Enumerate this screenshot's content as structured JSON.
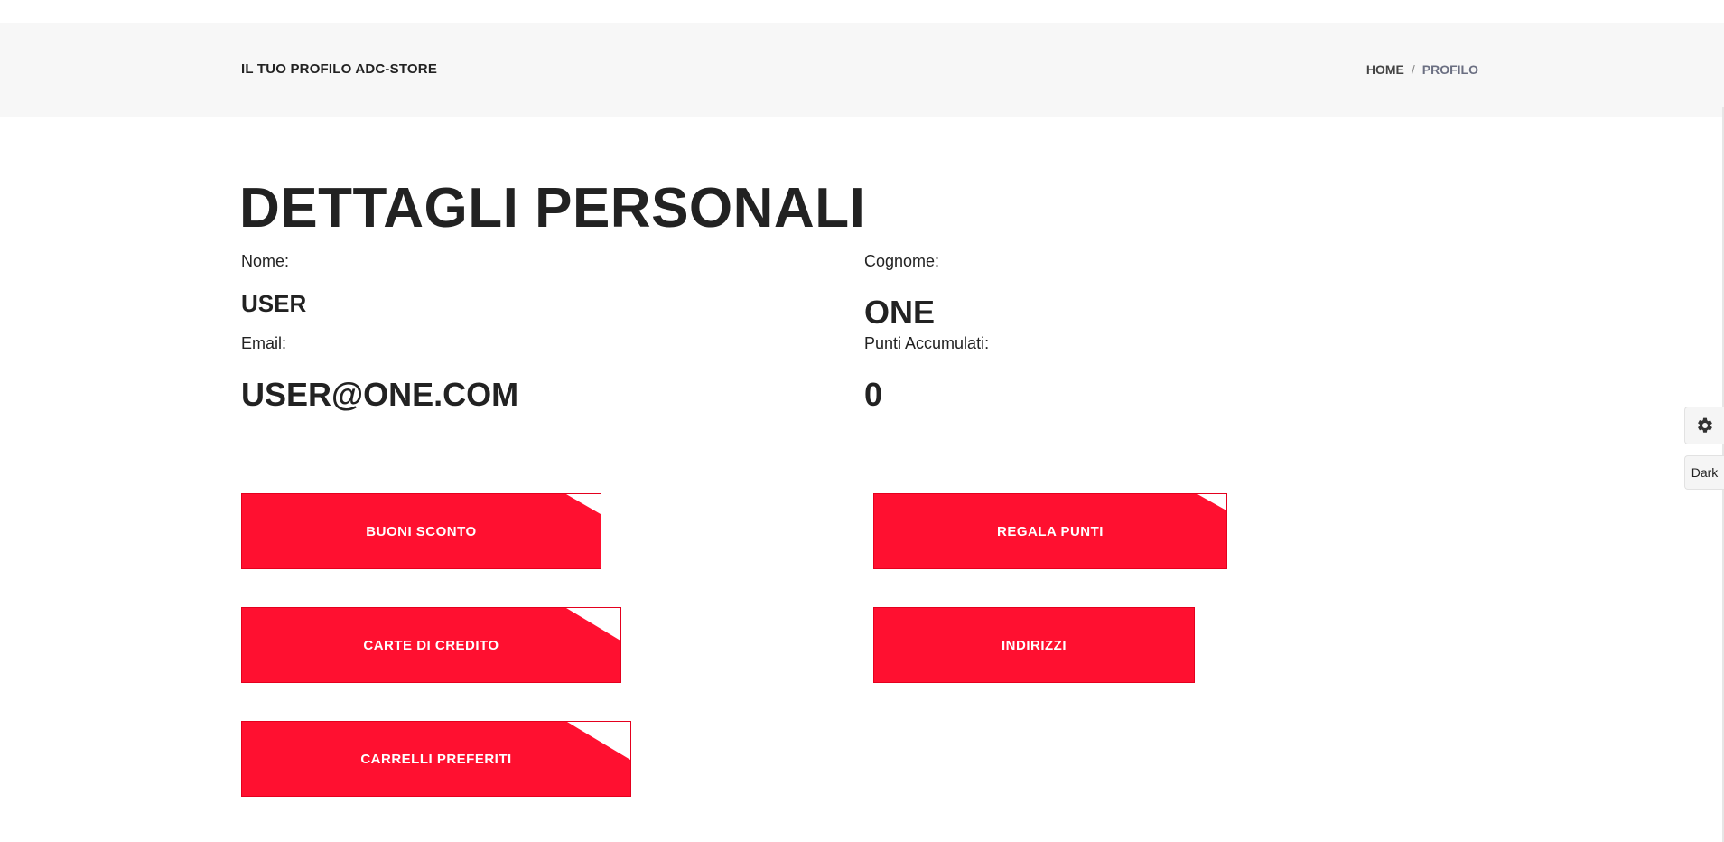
{
  "header": {
    "title": "IL TUO PROFILO ADC-STORE",
    "breadcrumb": {
      "home": "HOME",
      "separator": "/",
      "current": "PROFILO"
    }
  },
  "main": {
    "title": "DETTAGLI PERSONALI",
    "fields": {
      "nome": {
        "label": "Nome:",
        "value": "USER"
      },
      "cognome": {
        "label": "Cognome:",
        "value": "ONE"
      },
      "email": {
        "label": "Email:",
        "value": "USER@ONE.COM"
      },
      "punti": {
        "label": "Punti Accumulati:",
        "value": "0"
      }
    },
    "buttons": {
      "buoni_sconto": "BUONI SCONTO",
      "regala_punti": "REGALA PUNTI",
      "carte_di_credito": "CARTE DI CREDITO",
      "indirizzi": "INDIRIZZI",
      "carrelli_preferiti": "CARRELLI PREFERITI"
    }
  },
  "side_widget": {
    "settings_icon": "gear-icon",
    "theme_toggle": "Dark"
  },
  "colors": {
    "accent": "#ff1030",
    "header_bg": "#f7f7f7",
    "text": "#222222",
    "breadcrumb_current": "#6b6f82"
  }
}
